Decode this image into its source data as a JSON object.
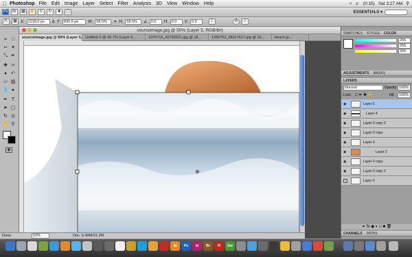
{
  "menubar": {
    "app_name": "Photoshop",
    "items": [
      "File",
      "Edit",
      "Image",
      "Layer",
      "Select",
      "Filter",
      "Analysis",
      "3D",
      "View",
      "Window",
      "Help"
    ],
    "battery": "(0:15)",
    "clock": "Sat 3:27 AM"
  },
  "appbar": {
    "workspace_label": "ESSENTIALS ▾"
  },
  "options": {
    "x_value": "1218.0 px",
    "y_value": "826.6 px",
    "w_label": "W:",
    "w_value": "58.5%",
    "h_label": "H:",
    "h_value": "58.5%",
    "angle_value": "0.0",
    "hskew_value": "0.0",
    "vskew_value": "0.0"
  },
  "document": {
    "title": "sourceimage.jpg @ 50% (Layer 5, RGB/8#)",
    "tabs": [
      "sourceimage.jpg @ 50% (Layer 5, RGB/8#)",
      "Untitled-1 @ 66.7% (Layer 6,...",
      "1070716_40752621.jpg @ 16...",
      "1266753_95317617.jpg @ 16...",
      "beach.jp..."
    ]
  },
  "status": {
    "zoom": "50%",
    "doc_info": "Doc: 5.49M/31.2M"
  },
  "panels": {
    "swatches_tabs": [
      "SWATCHES",
      "STYLES",
      "COLOR"
    ],
    "color": {
      "r": "255",
      "g": "255",
      "b": "255"
    },
    "adjustments_tabs": [
      "ADJUSTMENTS",
      "MASKS"
    ],
    "layers_tabs": [
      "LAYERS"
    ],
    "blend_mode": "Normal",
    "opacity_label": "Opacity:",
    "opacity_value": "100%",
    "lock_label": "Lock:",
    "fill_label": "Fill:",
    "fill_value": "100%",
    "layers": [
      {
        "name": "Layer 5",
        "selected": true
      },
      {
        "name": "Layer 4"
      },
      {
        "name": "Layer 0 copy 2"
      },
      {
        "name": "Layer 0 copy"
      },
      {
        "name": "Layer 3"
      },
      {
        "name": "Layer 2"
      },
      {
        "name": "Layer 0 copy"
      },
      {
        "name": "Layer 0 copy 2"
      },
      {
        "name": "Layer 0"
      }
    ],
    "channels_tabs": [
      "CHANNELS",
      "PATHS"
    ]
  },
  "dock": {
    "apps": [
      "Ai",
      "Ps",
      "Id",
      "Br",
      "Fl",
      "Dw"
    ]
  },
  "colors": {
    "accent_blue": "#3b74d6",
    "selected_layer": "#a7c6f0",
    "water_dark": "#5b7f9e",
    "water_light": "#eef4f8"
  }
}
